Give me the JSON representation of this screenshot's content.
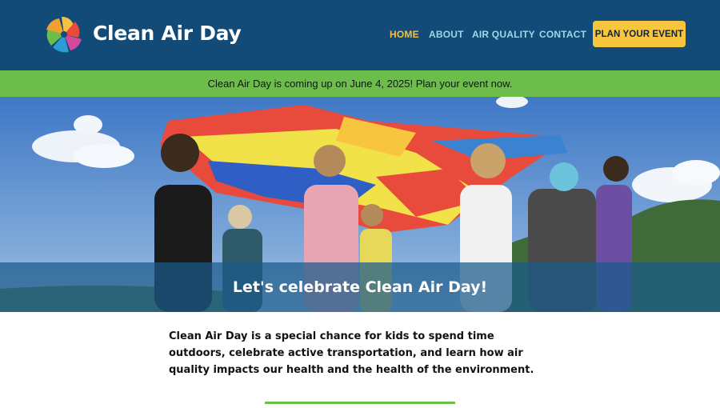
{
  "brand": {
    "name": "Clean Air Day",
    "logo_icon": "pinwheel-icon",
    "logo_colors": [
      "#f5c043",
      "#e84a3c",
      "#d14a9b",
      "#2d9bd6",
      "#6dbd4b"
    ]
  },
  "nav": {
    "items": [
      {
        "label": "HOME",
        "active": true
      },
      {
        "label": "ABOUT"
      },
      {
        "label": "AIR QUALITY"
      },
      {
        "label": "CONTACT"
      }
    ],
    "cta_label": "PLAN YOUR EVENT"
  },
  "announcement": {
    "text": "Clean Air Day is coming up on June 4, 2025! Plan your event now."
  },
  "hero": {
    "title": "Let's celebrate Clean Air Day!"
  },
  "intro": {
    "text": "Clean Air Day is a special chance for kids to spend time outdoors, celebrate active transportation, and learn how air quality impacts our health and the health of the environment."
  },
  "colors": {
    "header_bg": "#124b78",
    "accent_yellow": "#f7c53e",
    "accent_green": "#6dbd4b",
    "nav_link": "#9fd7e6"
  }
}
